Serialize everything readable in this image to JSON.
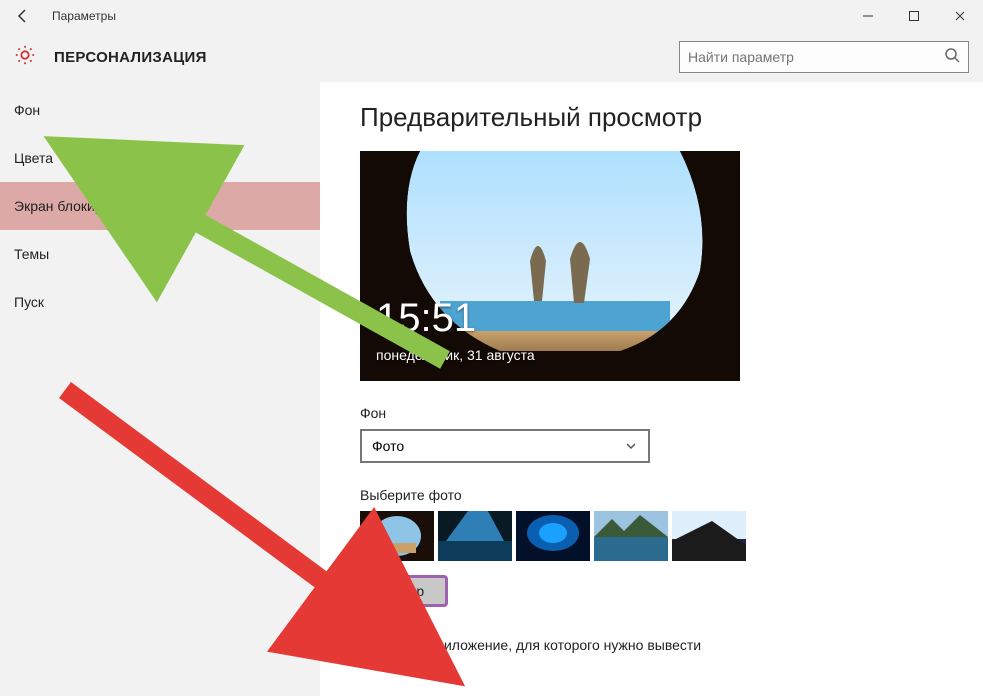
{
  "titlebar": {
    "title": "Параметры"
  },
  "header": {
    "section_title": "ПЕРСОНАЛИЗАЦИЯ",
    "search_placeholder": "Найти параметр"
  },
  "sidebar": {
    "items": [
      {
        "label": "Фон"
      },
      {
        "label": "Цвета"
      },
      {
        "label": "Экран блокировки"
      },
      {
        "label": "Темы"
      },
      {
        "label": "Пуск"
      }
    ],
    "active_index": 2
  },
  "content": {
    "preview_heading": "Предварительный просмотр",
    "clock": "15:51",
    "date": "понедельник, 31 августа",
    "bg_label": "Фон",
    "bg_value": "Фото",
    "choose_photo_label": "Выберите фото",
    "browse_label": "Обзор",
    "bottom_text": "Выберите приложение, для которого нужно вывести"
  }
}
